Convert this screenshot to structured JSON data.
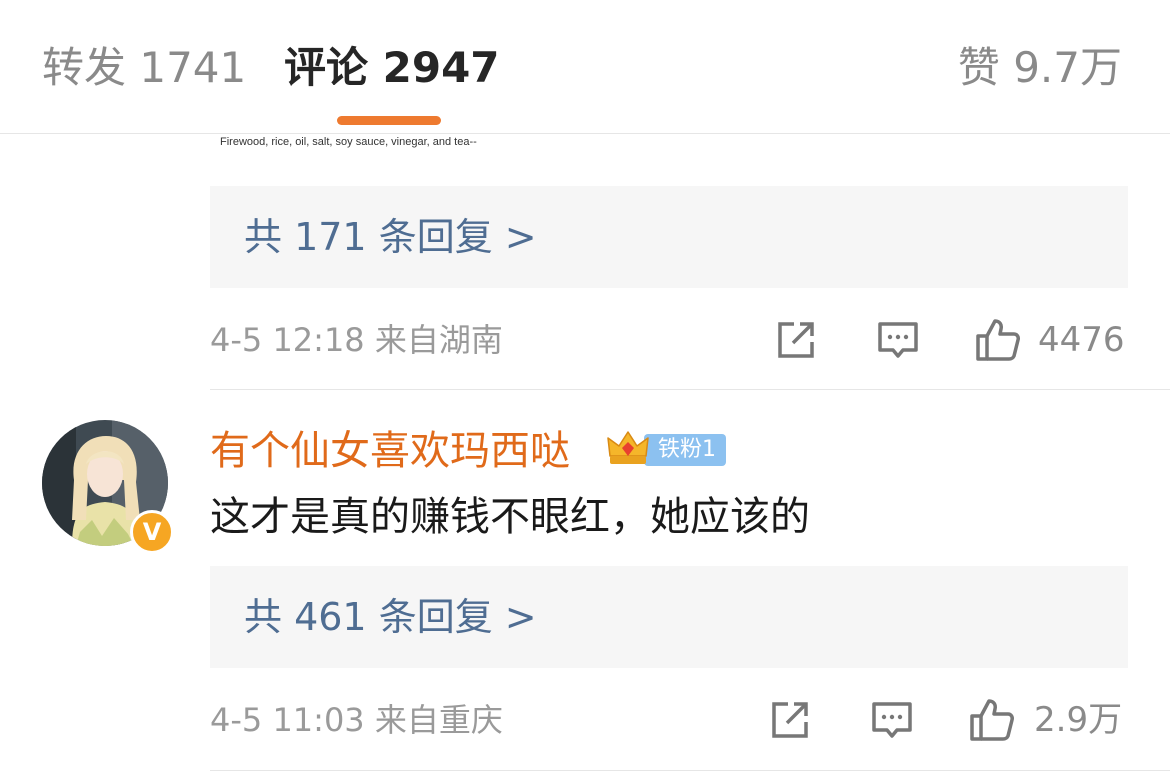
{
  "tabs": {
    "repost": "转发 1741",
    "comments": "评论 2947",
    "likes": "赞 9.7万"
  },
  "previous_comment": {
    "text_fragment": "Firewood, rice, oil, salt, soy sauce, vinegar, and tea--",
    "replies_link": "共 171 条回复 >",
    "time_location": "4-5 12:18  来自湖南",
    "like_count": "4476"
  },
  "comment": {
    "username": "有个仙女喜欢玛西哒",
    "fan_badge": "铁粉1",
    "verified_badge": "V",
    "text": "这才是真的赚钱不眼红，她应该的",
    "replies_link": "共 461 条回复 >",
    "time_location": "4-5 11:03  来自重庆",
    "like_count": "2.9万"
  },
  "icons": [
    "share-icon",
    "comment-icon",
    "like-icon",
    "crown-icon",
    "verified-icon"
  ],
  "colors": {
    "accent": "#ee7a2f",
    "username": "#e06a1a",
    "link": "#4f6d92",
    "fan_badge": "#8cc1f0",
    "verified_badge": "#f6a623"
  }
}
